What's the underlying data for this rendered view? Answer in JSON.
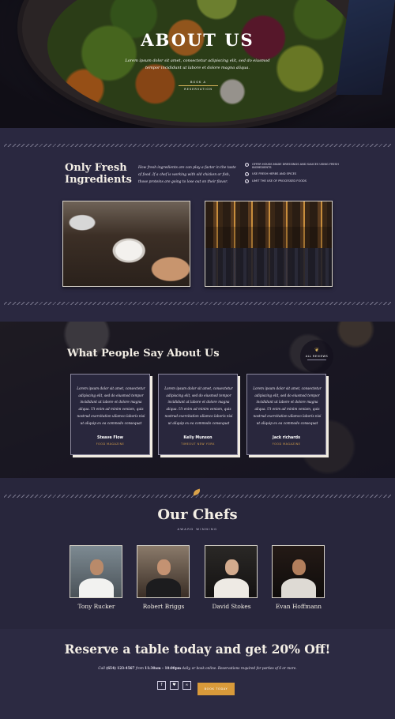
{
  "hero": {
    "title": "ABOUT US",
    "text": "Lorem ipsum dolor sit amet, consectetur adipiscing elit, sed do eiusmod tempor incididunt ut labore et dolore magna aliqua.",
    "button": "BOOK A RESERVATION"
  },
  "fresh": {
    "title_line1": "Only Fresh",
    "title_line2": "Ingredients",
    "text": "How fresh ingredients are can play a factor in the taste of food. If a chef is working with old chicken or fish, those proteins are going to lose out on their flavor.",
    "list": [
      "OFFER HOUSE-MADE DRESSINGS AND SAUCES USING FRESH INGREDIENTS",
      "USE FRESH HERBS AND SPICES",
      "LIMIT THE USE OF PROCESSED FOODS"
    ]
  },
  "testimonials": {
    "title": "What People Say About Us",
    "badge_label": "ALL REVIEWS",
    "cards": [
      {
        "quote": "Lorem ipsum dolor sit amet, consectetur adipiscing elit, sed do eiusmod tempor incididunt ut labore et dolore magna aliqua. Ut enim ad minim veniam, quis nostrud exercitation ullamco laboris nisi ut aliquip ex ea commodo consequat",
        "name": "Steave Flow",
        "org": "FOOD MAGAZINE"
      },
      {
        "quote": "Lorem ipsum dolor sit amet, consectetur adipiscing elit, sed do eiusmod tempor incididunt ut labore et dolore magna aliqua. Ut enim ad minim veniam, quis nostrud exercitation ullamco laboris nisi ut aliquip ex ea commodo consequat",
        "name": "Kelly Munson",
        "org": "TIMEOUT NEW YORK"
      },
      {
        "quote": "Lorem ipsum dolor sit amet, consectetur adipiscing elit, sed do eiusmod tempor incididunt ut labore et dolore magna aliqua. Ut enim ad minim veniam, quis nostrud exercitation ullamco laboris nisi ut aliquip ex ea commodo consequat",
        "name": "Jack richards",
        "org": "FOOD MAGAZINE"
      }
    ]
  },
  "chefs": {
    "title": "Our Chefs",
    "subtitle": "AWARD WINNING",
    "list": [
      {
        "name": "Tony Rucker"
      },
      {
        "name": "Robert Briggs"
      },
      {
        "name": "David Stokes"
      },
      {
        "name": "Evan Hoffmann"
      }
    ]
  },
  "reserve": {
    "title": "Reserve a table today and get 20% Off!",
    "text_pre": "Call ",
    "phone": "(654) 123-4567",
    "text_mid": " from ",
    "hours": "11:30am – 10:00pm",
    "text_post": " daily, or book online. Reservations required for parties of 6 or more.",
    "social": [
      "facebook-icon",
      "twitter-icon",
      "tripadvisor-icon"
    ],
    "button": "BOOK TODAY"
  },
  "colors": {
    "background": "#26243a",
    "accent": "#d99a3a",
    "text": "#f1ece2"
  }
}
